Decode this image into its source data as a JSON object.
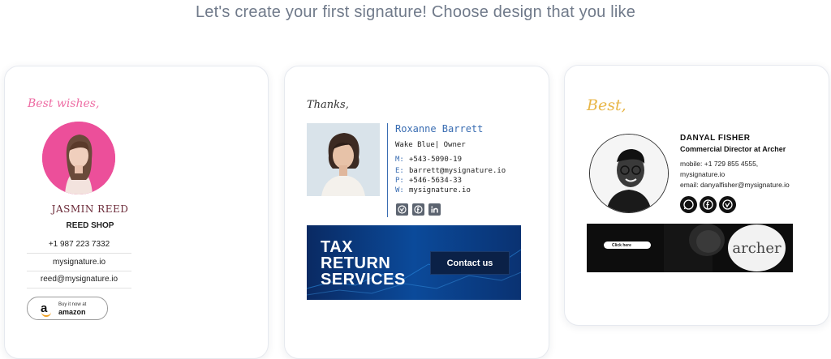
{
  "page": {
    "title": "Let's create your first signature! Choose design that you like"
  },
  "cards": [
    {
      "greeting": "Best wishes,",
      "name": "JASMIN REED",
      "company": "REED SHOP",
      "phone": "+1 987 223 7332",
      "website": "mysignature.io",
      "email": "reed@mysignature.io",
      "button": {
        "small": "Buy it now at",
        "brand": "amazon",
        "icon": "amazon-logo-icon"
      },
      "colors": {
        "greeting": "#ee6da4",
        "name": "#6b2a38",
        "avatar_bg": "#ec4f9a"
      }
    },
    {
      "greeting": "Thanks,",
      "name": "Roxanne Barrett",
      "title": "Wake Blue| Owner",
      "contacts": [
        {
          "key": "M:",
          "value": "+543-5090-19"
        },
        {
          "key": "E:",
          "value": "barrett@mysignature.io"
        },
        {
          "key": "P:",
          "value": "+546-5634-33"
        },
        {
          "key": "W:",
          "value": "mysignature.io"
        }
      ],
      "social_icons": [
        "vimeo-icon",
        "facebook-icon",
        "linkedin-icon"
      ],
      "banner": {
        "lines": [
          "TAX",
          "RETURN",
          "SERVICES"
        ],
        "button": "Contact us"
      },
      "colors": {
        "accent": "#3a6db2",
        "banner_bg": "#0a2f6e"
      }
    },
    {
      "greeting": "Best,",
      "name": "DANYAL FISHER",
      "role": "Commercial Director at Archer",
      "mobile": "mobile: +1 729 855 4555,",
      "website": "mysignature.io",
      "email": "email: danyalfisher@mysignature.io",
      "social_icons": [
        "whatsapp-icon",
        "facebook-icon",
        "vimeo-icon"
      ],
      "banner": {
        "button": "Click here",
        "logo": "archer"
      },
      "colors": {
        "greeting": "#e8b647"
      }
    }
  ]
}
